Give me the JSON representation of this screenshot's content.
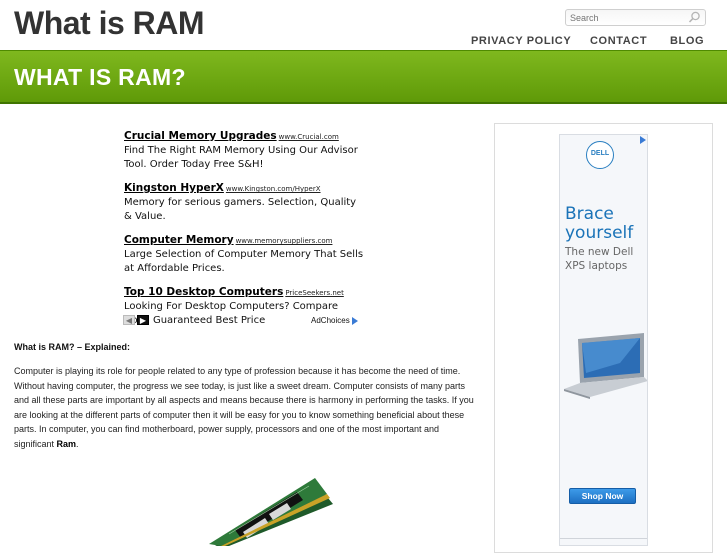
{
  "header": {
    "site_title": "What is RAM",
    "search_placeholder": "Search",
    "nav": [
      "PRIVACY POLICY",
      "CONTACT",
      "BLOG"
    ]
  },
  "banner": {
    "title": "WHAT IS RAM?"
  },
  "ads": {
    "items": [
      {
        "title": "Crucial Memory Upgrades",
        "url": "www.Crucial.com",
        "desc": "Find The Right RAM Memory Using Our Advisor Tool. Order Today Free S&H!"
      },
      {
        "title": "Kingston HyperX",
        "url": "www.Kingston.com/HyperX",
        "desc": "Memory for serious gamers. Selection, Quality & Value."
      },
      {
        "title": "Computer Memory",
        "url": "www.memorysuppliers.com",
        "desc": "Large Selection of Computer Memory That Sells at Affordable Prices."
      },
      {
        "title": "Top 10 Desktop Computers",
        "url": "PriceSeekers.net",
        "desc": "Looking For Desktop Computers? Compare Now! Guaranteed Best Price"
      }
    ],
    "adchoices_label": "AdChoices",
    "prev_icon": "chevron-left-icon",
    "next_icon": "chevron-right-icon"
  },
  "article": {
    "subheading": "What is RAM? – Explained:",
    "body": "Computer is playing its role for people related to any type of profession because it has become the need of time. Without having computer, the progress we see today, is just like a sweet dream. Computer consists of many parts and all these parts are important by all aspects and means because there is harmony in performing the tasks. If you are looking at the different parts of computer then it will be easy for you to know something beneficial about these parts. In computer, you can find motherboard, power supply, processors and one of the most important and significant ",
    "body_bold": "Ram",
    "body_end": "."
  },
  "sidebar_ad": {
    "logo_text": "DELL",
    "headline_line1": "Brace",
    "headline_line2": "yourself",
    "sub_line1": "The new Dell",
    "sub_line2": "XPS laptops",
    "button_label": "Shop Now"
  },
  "colors": {
    "banner_green": "#6aa810",
    "dell_blue": "#1a73b8",
    "button_blue": "#2a84d6"
  }
}
